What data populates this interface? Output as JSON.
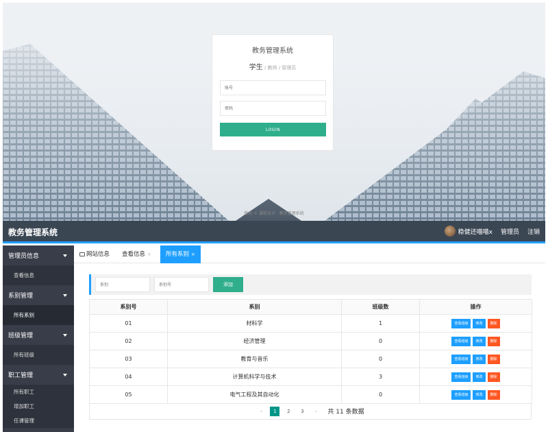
{
  "login": {
    "title": "教务管理系统",
    "role_active": "学生",
    "role_others": " / 教师 / 管理员",
    "username_placeholder": "账号",
    "password_placeholder": "密码",
    "login_button": "LOGIN",
    "footer": "版权 © 课程设计 · 教务管理系统"
  },
  "header": {
    "app_title": "教务管理系统",
    "user_name": "稳健还喵喵x",
    "role": "管理员",
    "logout": "注销"
  },
  "sidebar": {
    "groups": [
      {
        "label": "管理员信息",
        "items": [
          "查看信息"
        ]
      },
      {
        "label": "系别管理",
        "items": [
          "所有系别"
        ]
      },
      {
        "label": "班级管理",
        "items": [
          "所有班级"
        ]
      },
      {
        "label": "职工管理",
        "items": [
          "所有职工",
          "增加职工",
          "任课管理"
        ]
      }
    ]
  },
  "tabs": [
    {
      "label": "网站信息"
    },
    {
      "label": "查看信息",
      "close": "×"
    },
    {
      "label": "所有系别",
      "close": "×"
    }
  ],
  "filter": {
    "dept_placeholder": "系别",
    "dept_no_placeholder": "系别号",
    "add_button": "添加"
  },
  "table": {
    "columns": [
      "系别号",
      "系别",
      "班级数",
      "操作"
    ],
    "actions": {
      "view": "查看班级",
      "edit": "修改",
      "delete": "删除"
    },
    "rows": [
      {
        "no": "01",
        "name": "材料学",
        "classes": "1"
      },
      {
        "no": "02",
        "name": "经济管理",
        "classes": "0"
      },
      {
        "no": "03",
        "name": "教育与音乐",
        "classes": "0"
      },
      {
        "no": "04",
        "name": "计算机科学与技术",
        "classes": "3"
      },
      {
        "no": "05",
        "name": "电气工程及其自动化",
        "classes": "0"
      }
    ]
  },
  "pagination": {
    "prev": "‹",
    "pages": [
      "1",
      "2",
      "3"
    ],
    "next": "›",
    "total": "共 11 条数据",
    "current": "1"
  }
}
